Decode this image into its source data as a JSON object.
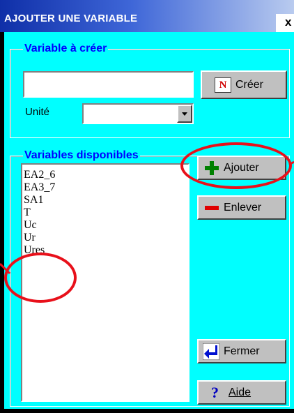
{
  "window": {
    "title": "AJOUTER UNE VARIABLE",
    "close_glyph": "x"
  },
  "create_group": {
    "title": "Variable à créer",
    "name_input_value": "",
    "create_button_label": "Créer",
    "unit_label": "Unité",
    "unit_value": ""
  },
  "available_group": {
    "title": "Variables disponibles",
    "items": [
      "EA2_6",
      "EA3_7",
      "SA1",
      "T",
      "Uc",
      "Ur",
      "Ures"
    ]
  },
  "buttons": {
    "add": "Ajouter",
    "remove": "Enlever",
    "close": "Fermer",
    "help": "Aide"
  },
  "icons": {
    "create": "create-variable-icon",
    "add": "plus-icon",
    "remove": "minus-icon",
    "close": "return-arrow-icon",
    "help": "question-mark-icon"
  },
  "annotation_color": "#e8101a"
}
